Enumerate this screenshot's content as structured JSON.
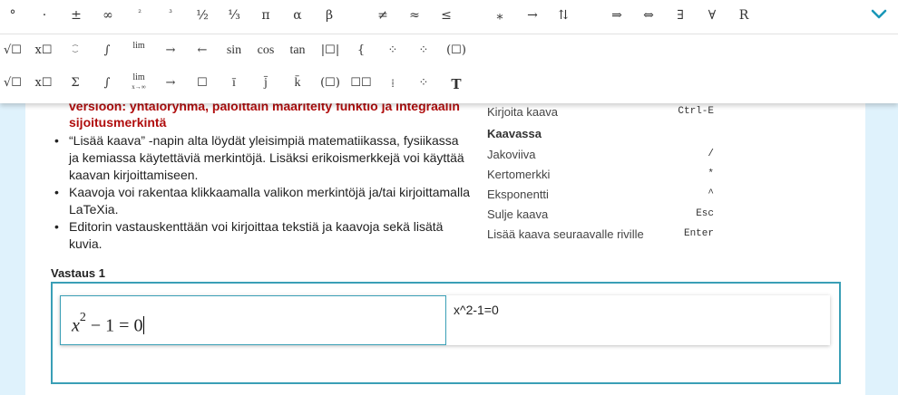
{
  "toolbar": {
    "row1": [
      "°",
      "·",
      "±",
      "∞",
      "²",
      "³",
      "½",
      "⅓",
      "π",
      "α",
      "β",
      "≠",
      "≈",
      "≤",
      "⁎",
      "→",
      "⇅",
      "⇒",
      "⇔",
      "∃",
      "∀",
      "R"
    ],
    "row2": [
      "√☐",
      "x☐",
      "⁐",
      "∫",
      "lim",
      "→",
      "←",
      "sin",
      "cos",
      "tan",
      "|☐|",
      "{",
      "⁘",
      "⁘",
      "⁘",
      "(☐)"
    ],
    "row3": [
      "√☐",
      "x☐",
      "Σ",
      "∫",
      "lim",
      "→",
      "☐",
      "ī",
      "j̄",
      "k̄",
      "(☐)",
      "☐☐",
      "⁞",
      "⁘",
      "T"
    ],
    "row2_lim": "lim",
    "row3_lim_top": "lim",
    "row3_lim_bottom": "x→∞",
    "accent_color": "#1a97b8"
  },
  "content": {
    "warning_lines": [
      "versioon: yhtälöryhmä, paloittain määritelty funktio ja integraalin",
      "sijoitusmerkintä"
    ],
    "bullets": [
      "“Lisää kaava” -napin alta löydät yleisimpiä matematiikassa, fysiikassa ja kemiassa käytettäviä merkintöjä. Lisäksi erikoismerkkejä voi käyttää kaavan kirjoittamiseen.",
      "Kaavoja voi rakentaa klikkaamalla valikon merkintöjä ja/tai kirjoittamalla LaTeXia.",
      "Editorin vastauskenttään voi kirjoittaa tekstiä ja kaavoja sekä lisätä kuvia."
    ]
  },
  "shortcuts": {
    "first": {
      "label": "Kirjoita kaava",
      "key": "Ctrl-E"
    },
    "heading": "Kaavassa",
    "items": [
      {
        "label": "Jakoviiva",
        "key": "/"
      },
      {
        "label": "Kertomerkki",
        "key": "*"
      },
      {
        "label": "Eksponentti",
        "key": "^"
      },
      {
        "label": "Sulje kaava",
        "key": "Esc"
      },
      {
        "label": "Lisää kaava seuraavalle riville",
        "key": "Enter"
      }
    ]
  },
  "answer": {
    "label": "Vastaus 1",
    "formula_base": "x",
    "formula_exp": "2",
    "formula_rest": " − 1 = 0",
    "latex": "x^2-1=0"
  }
}
